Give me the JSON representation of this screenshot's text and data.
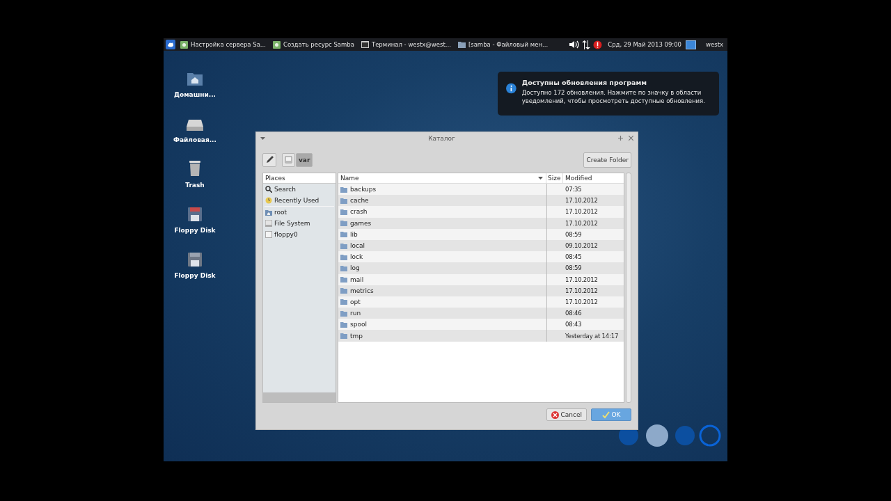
{
  "taskbar": {
    "tasks": [
      {
        "kind": "settings",
        "label": "Настройка сервера Sa..."
      },
      {
        "kind": "settings",
        "label": "Создать ресурс Samba"
      },
      {
        "kind": "terminal",
        "label": "Терминал - westx@west..."
      },
      {
        "kind": "folder",
        "label": "[samba - Файловый мен..."
      }
    ],
    "clock": "Срд, 29 Май 2013 09:00",
    "user": "westx"
  },
  "desktop_icons": [
    {
      "kind": "home",
      "label": "Домашни..."
    },
    {
      "kind": "drive",
      "label": "Файловая..."
    },
    {
      "kind": "trash",
      "label": "Trash"
    },
    {
      "kind": "floppy-red",
      "label": "Floppy Disk"
    },
    {
      "kind": "floppy",
      "label": "Floppy Disk"
    }
  ],
  "notification": {
    "title": "Доступны обновления программ",
    "body": "Доступно 172 обновления. Нажмите по значку в области уведомлений, чтобы просмотреть доступные обновления."
  },
  "dialog": {
    "title": "Каталог",
    "path": [
      {
        "kind": "drive",
        "selected": false
      },
      {
        "kind": "text",
        "label": "var",
        "selected": true
      }
    ],
    "create_folder": "Create Folder",
    "places_header": "Places",
    "places": [
      {
        "kind": "search",
        "label": "Search"
      },
      {
        "kind": "recent",
        "label": "Recently Used"
      },
      {
        "kind": "home",
        "label": "root"
      },
      {
        "kind": "drive",
        "label": "File System"
      },
      {
        "kind": "removable",
        "label": "floppy0"
      }
    ],
    "columns": [
      "Name",
      "Size",
      "Modified"
    ],
    "rows": [
      {
        "name": "backups",
        "modified": "07:35"
      },
      {
        "name": "cache",
        "modified": "17.10.2012"
      },
      {
        "name": "crash",
        "modified": "17.10.2012"
      },
      {
        "name": "games",
        "modified": "17.10.2012"
      },
      {
        "name": "lib",
        "modified": "08:59"
      },
      {
        "name": "local",
        "modified": "09.10.2012"
      },
      {
        "name": "lock",
        "modified": "08:45"
      },
      {
        "name": "log",
        "modified": "08:59"
      },
      {
        "name": "mail",
        "modified": "17.10.2012"
      },
      {
        "name": "metrics",
        "modified": "17.10.2012"
      },
      {
        "name": "opt",
        "modified": "17.10.2012"
      },
      {
        "name": "run",
        "modified": "08:46"
      },
      {
        "name": "spool",
        "modified": "08:43"
      },
      {
        "name": "tmp",
        "modified": "Yesterday at 14:17"
      }
    ],
    "buttons": [
      {
        "kind": "cancel",
        "label": "Cancel"
      },
      {
        "kind": "ok",
        "label": "OK"
      }
    ]
  }
}
